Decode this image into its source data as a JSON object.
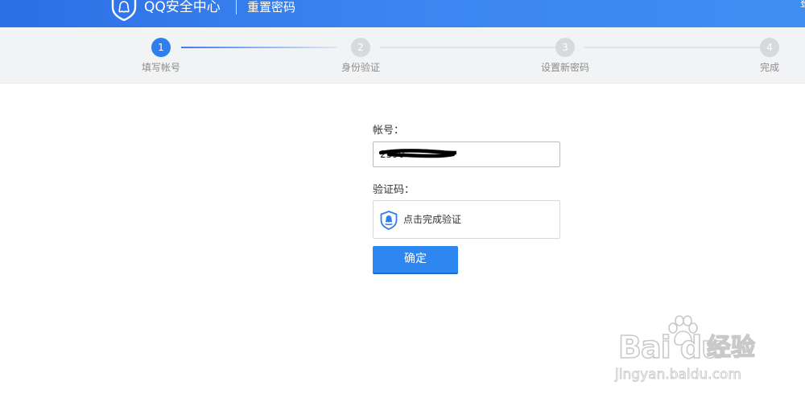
{
  "header": {
    "brand": "QQ安全中心",
    "page_name": "重置密码",
    "edge_text": "登"
  },
  "steps": [
    {
      "number": "1",
      "label": "填写帐号",
      "active": true
    },
    {
      "number": "2",
      "label": "身份验证",
      "active": false
    },
    {
      "number": "3",
      "label": "设置新密码",
      "active": false
    },
    {
      "number": "4",
      "label": "完成",
      "active": false
    }
  ],
  "form": {
    "account_label": "帐号：",
    "account_value": "2590",
    "captcha_label": "验证码：",
    "captcha_prompt": "点击完成验证",
    "confirm_label": "确定"
  },
  "watermark": {
    "main": "Bai du",
    "cn": "经验",
    "url": "jingyan.baidu.com"
  },
  "colors": {
    "header_blue": "#3a84ef",
    "step_active": "#2f7eee",
    "step_inactive": "#d7d9dc",
    "button_blue": "#2e86f0"
  }
}
